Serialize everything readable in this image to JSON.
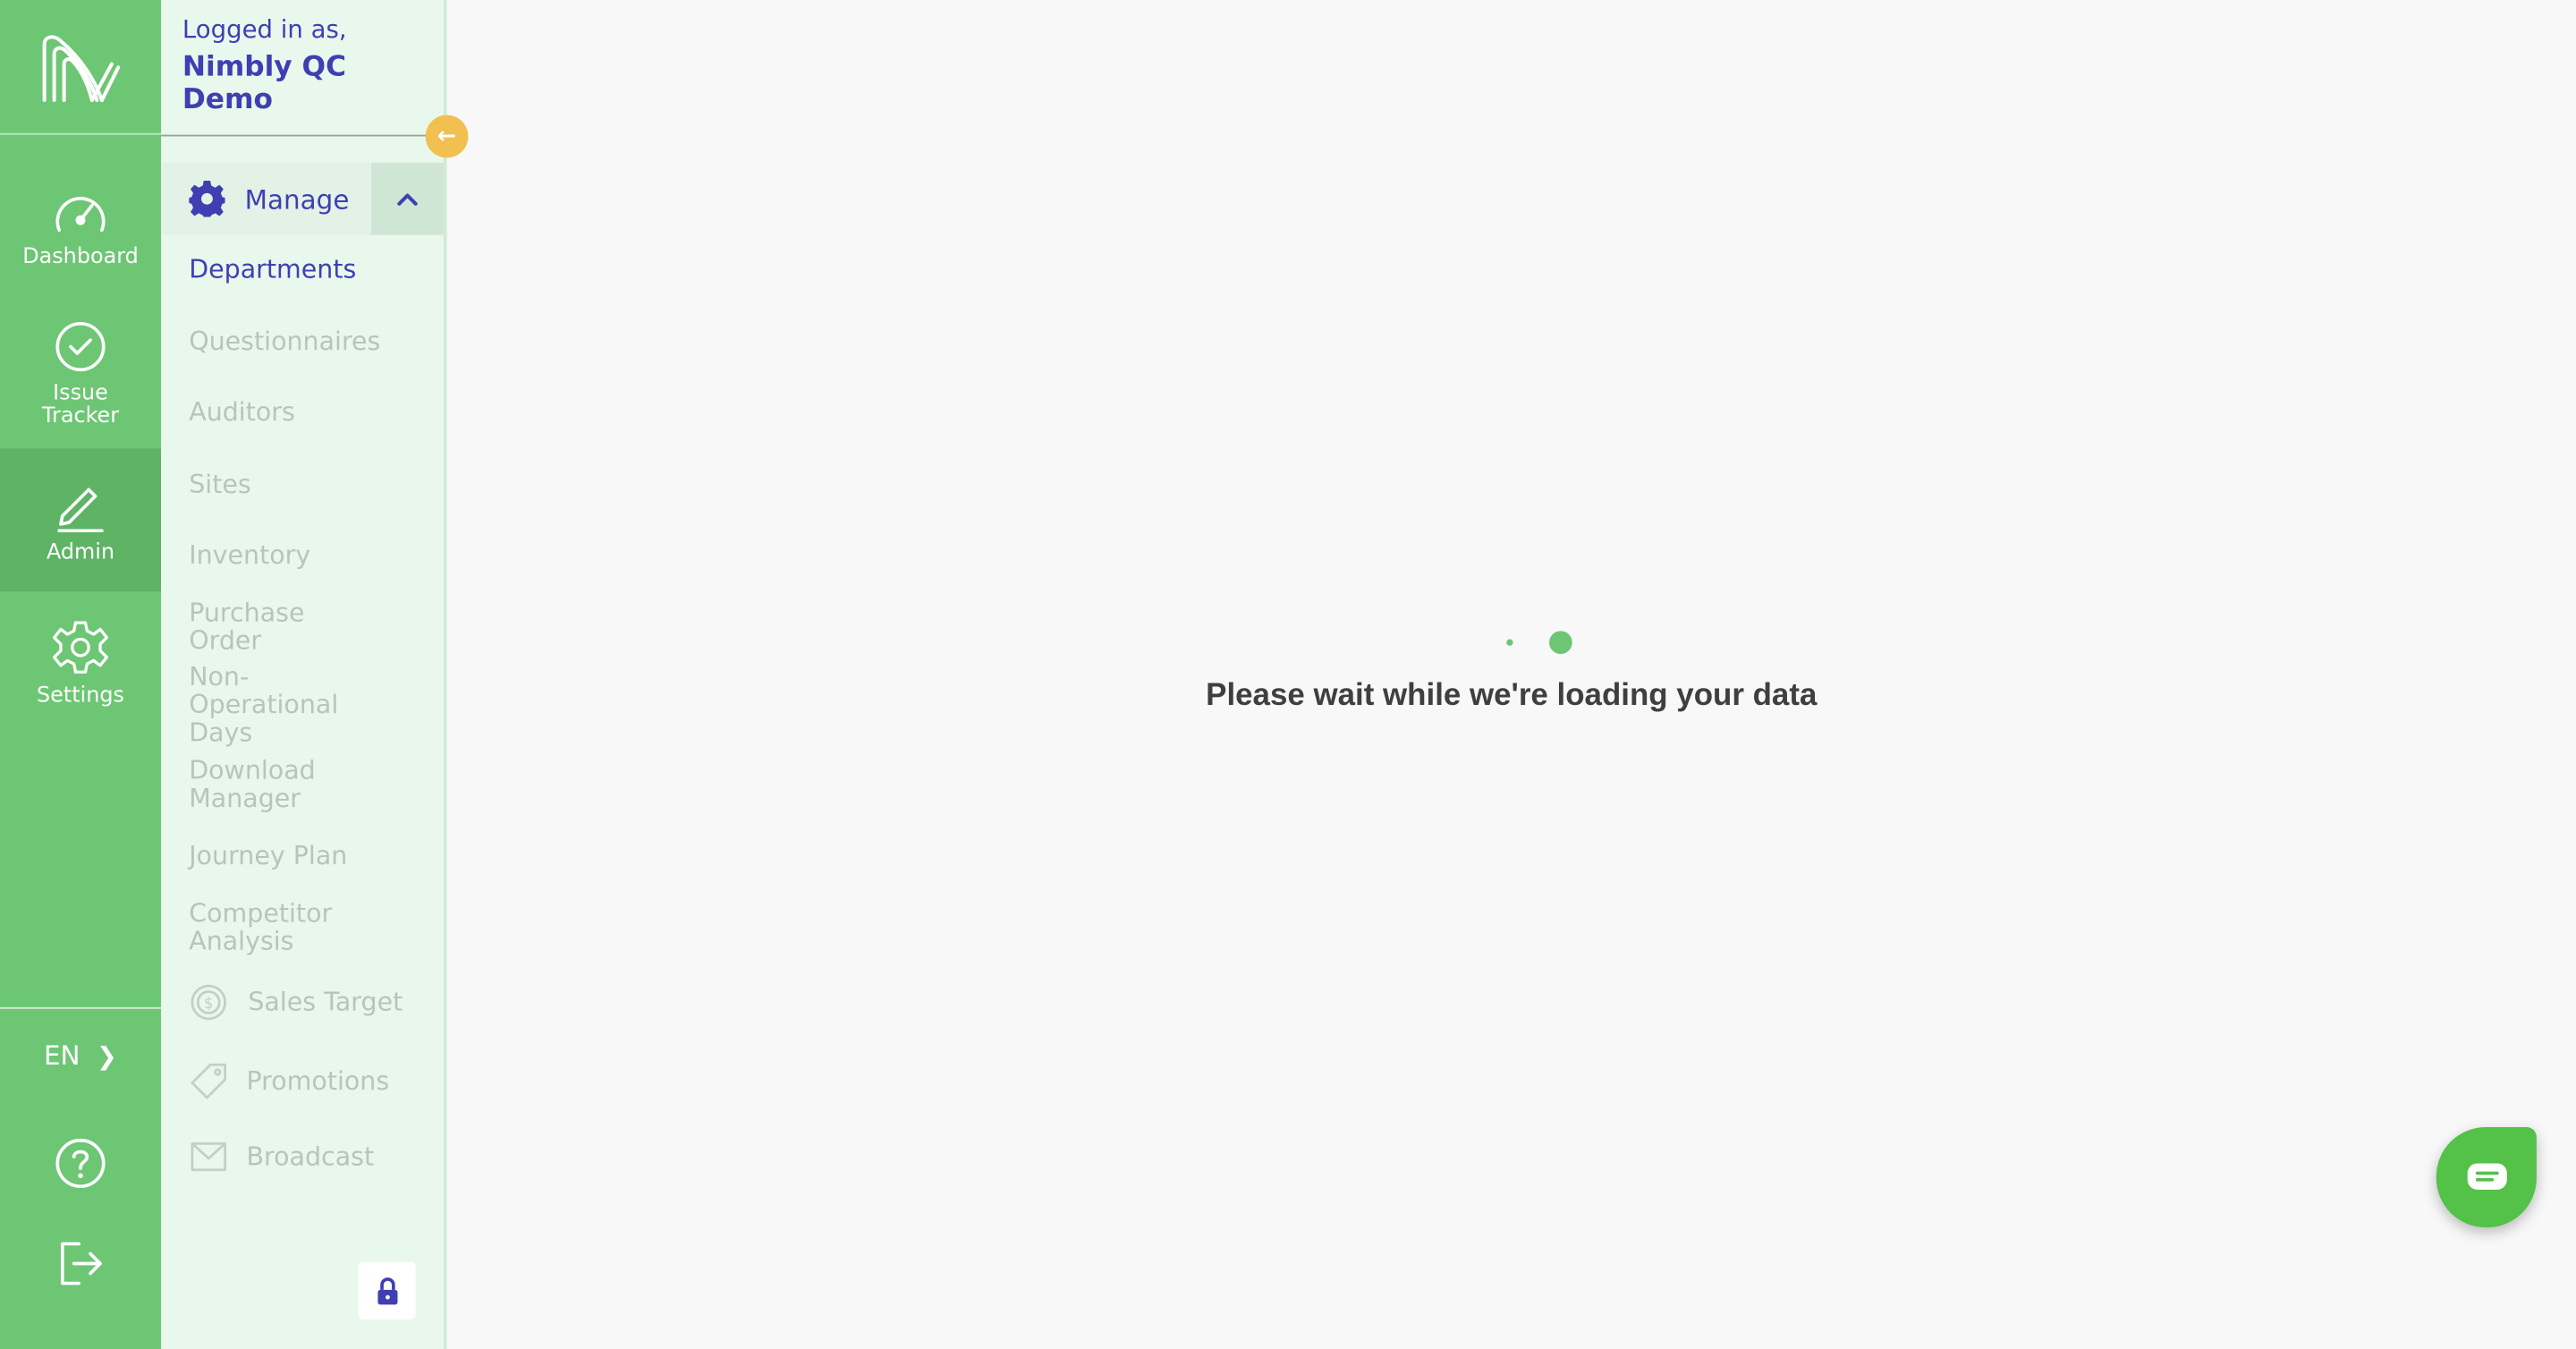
{
  "rail": {
    "items": [
      {
        "label": "Dashboard",
        "icon": "speedometer-icon"
      },
      {
        "label": "Issue Tracker",
        "icon": "check-circle-icon"
      },
      {
        "label": "Admin",
        "icon": "pencil-icon",
        "active": true
      },
      {
        "label": "Settings",
        "icon": "gear-icon"
      }
    ],
    "language": "EN"
  },
  "panel": {
    "logged_in_label": "Logged in as,",
    "user_name": "Nimbly QC Demo",
    "manage_label": "Manage",
    "menu": [
      "Departments",
      "Questionnaires",
      "Auditors",
      "Sites",
      "Inventory",
      "Purchase Order",
      "Non-Operational Days",
      "Download Manager",
      "Journey Plan",
      "Competitor Analysis"
    ],
    "selected_item": "Departments",
    "icon_menu": [
      {
        "label": "Sales Target",
        "icon": "dollar-coin-icon"
      },
      {
        "label": "Promotions",
        "icon": "tag-icon"
      },
      {
        "label": "Broadcast",
        "icon": "envelope-icon"
      }
    ]
  },
  "main": {
    "loading_message": "Please wait while we're loading your data"
  },
  "colors": {
    "rail": "#6dc674",
    "panel": "#e8f8ec",
    "accent": "#3f3fb3",
    "collapse": "#f0c050",
    "chat": "#54c149"
  }
}
